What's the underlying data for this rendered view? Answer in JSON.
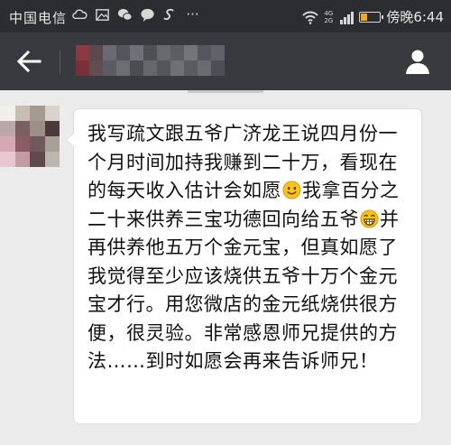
{
  "status_bar": {
    "carrier": "中国电信",
    "net_type": "4G 2G",
    "time": "傍晚6:44",
    "battery_level": 0.35,
    "icons": [
      "cloud-icon",
      "image-icon",
      "wechat-icon",
      "chat-bubble-icon",
      "sougou-icon",
      "more-icon",
      "wifi-icon",
      "signal-icon",
      "battery-icon"
    ]
  },
  "header": {
    "title_redacted": true,
    "back_icon": "back-arrow-icon",
    "profile_icon": "profile-icon"
  },
  "message": {
    "segments": [
      "我写疏文跟五爷广济龙王说四月份一个月时间加持我赚到二十万，看现在的每天收入估计会如愿",
      "我拿百分之二十来供养三宝功德回向给五爷",
      "并再供养他五万个金元宝，但真如愿了我觉得至少应该烧供五爷十万个金元宝才行。用您微店的金元纸烧供很方便，很灵验。非常感恩师兄提供的方法……到时如愿会再来告诉师兄！"
    ],
    "emojis": [
      "smile-emoji",
      "grin-emoji"
    ]
  },
  "colors": {
    "status_bar": "#2b2d30",
    "app_bar": "#393a3f",
    "chat_bg": "#ebebeb",
    "bubble": "#ffffff"
  }
}
